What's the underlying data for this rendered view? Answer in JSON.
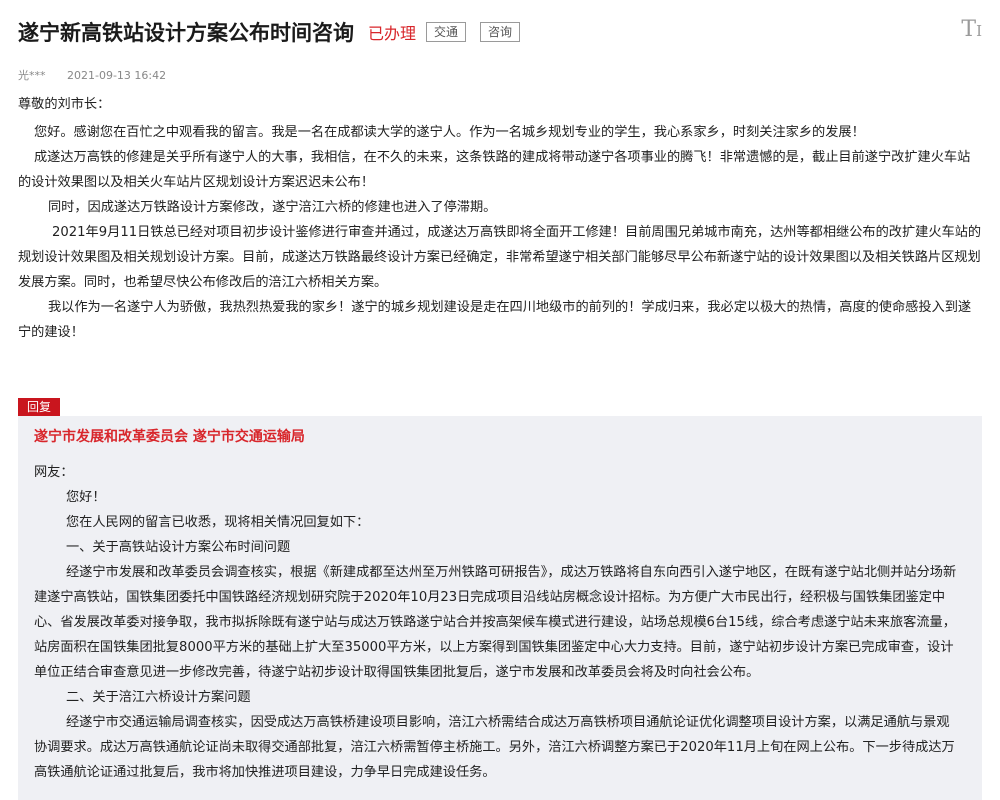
{
  "header": {
    "title": "遂宁新高铁站设计方案公布时间咨询",
    "status": "已办理",
    "tags": [
      "交通",
      "咨询"
    ],
    "font_size_icon": "font-size-icon"
  },
  "meta": {
    "author": "光***",
    "time": "2021-09-13 16:42"
  },
  "message": {
    "salutation": "尊敬的刘市长：",
    "paragraphs": [
      "您好。感谢您在百忙之中观看我的留言。我是一名在成都读大学的遂宁人。作为一名城乡规划专业的学生，我心系家乡，时刻关注家乡的发展！",
      "成遂达万高铁的修建是关乎所有遂宁人的大事，我相信，在不久的未来，这条铁路的建成将带动遂宁各项事业的腾飞！非常遗憾的是，截止目前遂宁改扩建火车站的设计效果图以及相关火车站片区规划设计方案迟迟未公布！",
      "同时，因成遂达万铁路设计方案修改，遂宁涪江六桥的修建也进入了停滞期。",
      "2021年9月11日铁总已经对项目初步设计鉴修进行审查并通过，成遂达万高铁即将全面开工修建！目前周围兄弟城市南充，达州等都相继公布的改扩建火车站的规划设计效果图及相关规划设计方案。目前，成遂达万铁路最终设计方案已经确定，非常希望遂宁相关部门能够尽早公布新遂宁站的设计效果图以及相关铁路片区规划发展方案。同时，也希望尽快公布修改后的涪江六桥相关方案。",
      "我以作为一名遂宁人为骄傲，我热烈热爱我的家乡！遂宁的城乡规划建设是走在四川地级市的前列的！学成归来，我必定以极大的热情，高度的使命感投入到遂宁的建设！"
    ]
  },
  "reply": {
    "badge": "回复",
    "org": "遂宁市发展和改革委员会 遂宁市交通运输局",
    "addressee": "网友：",
    "paragraphs": [
      "您好！",
      "您在人民网的留言已收悉，现将相关情况回复如下：",
      "一、关于高铁站设计方案公布时间问题",
      "经遂宁市发展和改革委员会调查核实，根据《新建成都至达州至万州铁路可研报告》，成达万铁路将自东向西引入遂宁地区，在既有遂宁站北侧并站分场新建遂宁高铁站，国铁集团委托中国铁路经济规划研究院于2020年10月23日完成项目沿线站房概念设计招标。为方便广大市民出行，经积极与国铁集团鉴定中心、省发展改革委对接争取，我市拟拆除既有遂宁站与成达万铁路遂宁站合并按高架候车模式进行建设，站场总规模6台15线，综合考虑遂宁站未来旅客流量，站房面积在国铁集团批复8000平方米的基础上扩大至35000平方米，以上方案得到国铁集团鉴定中心大力支持。目前，遂宁站初步设计方案已完成审查，设计单位正结合审查意见进一步修改完善，待遂宁站初步设计取得国铁集团批复后，遂宁市发展和改革委员会将及时向社会公布。",
      "二、关于涪江六桥设计方案问题",
      "经遂宁市交通运输局调查核实，因受成达万高铁桥建设项目影响，涪江六桥需结合成达万高铁桥项目通航论证优化调整项目设计方案，以满足通航与景观协调要求。成达万高铁通航论证尚未取得交通部批复，涪江六桥需暂停主桥施工。另外，涪江六桥调整方案已于2020年11月上旬在网上公布。下一步待成达万高铁通航论证通过批复后，我市将加快推进项目建设，力争早日完成建设任务。"
    ]
  }
}
